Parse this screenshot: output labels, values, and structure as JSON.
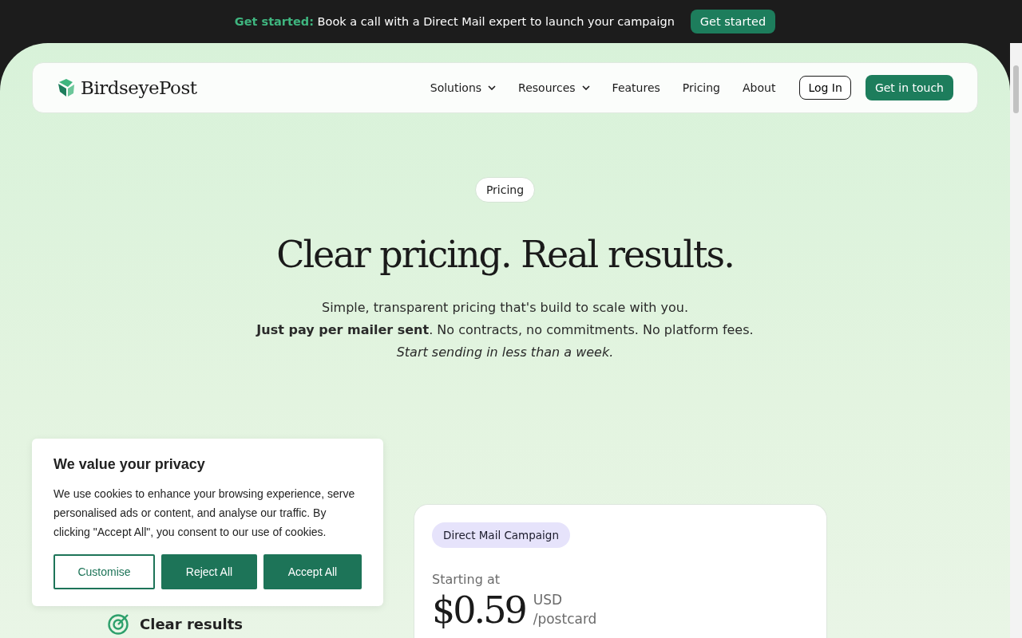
{
  "promo_bar": {
    "lead": "Get started:",
    "text": "Book a call with a Direct Mail expert to launch your campaign",
    "button": "Get started"
  },
  "header": {
    "logo": "BirdseyePost",
    "nav": [
      {
        "label": "Solutions",
        "dropdown": true
      },
      {
        "label": "Resources",
        "dropdown": true
      },
      {
        "label": "Features",
        "dropdown": false
      },
      {
        "label": "Pricing",
        "dropdown": false
      },
      {
        "label": "About",
        "dropdown": false
      }
    ],
    "login": "Log In",
    "cta": "Get in touch"
  },
  "hero": {
    "tag": "Pricing",
    "title": "Clear pricing. Real results.",
    "lines": [
      {
        "text": "Simple, transparent pricing that's build to scale with you.",
        "italic": false
      },
      {
        "text": "**Just pay per mailer sent**. No contracts, no commitments. No platform fees.",
        "italic": false
      },
      {
        "text": "Start sending in less than a week.",
        "italic": true
      }
    ]
  },
  "features": [
    {
      "label": "Clear results"
    }
  ],
  "price_card": {
    "tag": "Direct Mail Campaign",
    "starting": "Starting at",
    "price": "$0.59",
    "currency": "USD",
    "unit": "/postcard"
  },
  "cookie_banner": {
    "title": "We value your privacy",
    "text": "We use cookies to enhance your browsing experience, serve personalised ads or content, and analyse our traffic. By clicking \"Accept All\", you consent to our use of cookies.",
    "buttons": [
      {
        "label": "Customise",
        "kind": "outline"
      },
      {
        "label": "Reject All",
        "kind": "solid"
      },
      {
        "label": "Accept All",
        "kind": "solid"
      }
    ]
  }
}
